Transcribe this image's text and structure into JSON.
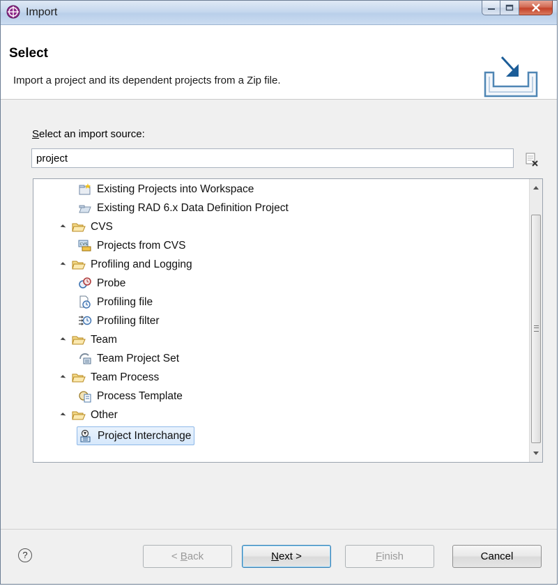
{
  "window": {
    "title": "Import"
  },
  "header": {
    "title": "Select",
    "description": "Import a project and its dependent projects from a Zip file."
  },
  "source": {
    "label_mnemonic": "S",
    "label_rest": "elect an import source:",
    "filter_value": "project"
  },
  "tree": {
    "items": [
      {
        "label": "Existing Projects into Workspace",
        "icon": "projects-into-workspace-icon",
        "level": 1
      },
      {
        "label": "Existing RAD 6.x Data Definition Project",
        "icon": "data-definition-icon",
        "level": 1
      },
      {
        "label": "CVS",
        "icon": "folder-open-icon",
        "level": 0
      },
      {
        "label": "Projects from CVS",
        "icon": "cvs-icon",
        "level": 1
      },
      {
        "label": "Profiling and Logging",
        "icon": "folder-open-icon",
        "level": 0
      },
      {
        "label": "Probe",
        "icon": "probe-icon",
        "level": 1
      },
      {
        "label": "Profiling file",
        "icon": "profiling-file-icon",
        "level": 1
      },
      {
        "label": "Profiling filter",
        "icon": "profiling-filter-icon",
        "level": 1
      },
      {
        "label": "Team",
        "icon": "folder-open-icon",
        "level": 0
      },
      {
        "label": "Team Project Set",
        "icon": "team-project-set-icon",
        "level": 1
      },
      {
        "label": "Team Process",
        "icon": "folder-open-icon",
        "level": 0
      },
      {
        "label": "Process Template",
        "icon": "process-template-icon",
        "level": 1
      },
      {
        "label": "Other",
        "icon": "folder-open-icon",
        "level": 0
      },
      {
        "label": "Project Interchange",
        "icon": "project-interchange-icon",
        "level": 1,
        "selected": true
      }
    ]
  },
  "buttons": {
    "back_prefix": "< ",
    "back_mnemonic": "B",
    "back_rest": "ack",
    "next_mnemonic": "N",
    "next_rest": "ext >",
    "finish_mnemonic": "F",
    "finish_rest": "inish",
    "cancel": "Cancel"
  },
  "colors": {
    "selection_bg": "#d6e8fb",
    "selection_border": "#8db8e8",
    "folder": "#e8c15c"
  }
}
